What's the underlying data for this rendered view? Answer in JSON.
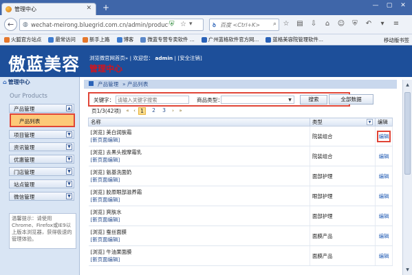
{
  "browser": {
    "tab_title": "管理中心",
    "url": "wechat-meirong.bluegrid.com.cn/admin/productlis",
    "search_placeholder": "百度 <Ctrl+K>"
  },
  "bookmarks": {
    "items": [
      {
        "label": "火狐官方站点",
        "color": "#e5772c"
      },
      {
        "label": "最常访问",
        "color": "#3d7bd0"
      },
      {
        "label": "新手上路",
        "color": "#e5772c"
      },
      {
        "label": "博客",
        "color": "#3d7bd0"
      },
      {
        "label": "微蓝专营专卖软件 ...",
        "color": "#5a87c9"
      },
      {
        "label": "广州蓝格软件官方网...",
        "color": "#2a62b8"
      },
      {
        "label": "蓝格美容院管理软件...",
        "color": "#2a62b8"
      }
    ],
    "mobile_label": "移动版书签"
  },
  "site": {
    "logo": "傲蓝美容",
    "link_home": "浏览微官网首页»",
    "welcome": "| 欢迎您：",
    "user": "admin",
    "logout": "| [安全注销]",
    "title": "管理中心"
  },
  "sidebar": {
    "header": "管理中心",
    "section": "Our Products",
    "groups": [
      "产品管理",
      "项目管理",
      "资讯管理",
      "优惠管理",
      "门店管理",
      "站点管理",
      "微信管理"
    ],
    "active_item": "产品列表",
    "tip": "温馨提示：请使用Chrome、Firefox或IE9以上版本浏览器，获得极速的管理体验。"
  },
  "breadcrumb": {
    "level1": "产品管理",
    "level2": "» 产品列表"
  },
  "filter": {
    "keyword_label": "关键字：",
    "keyword_placeholder": "请输入关键字搜索",
    "type_label": "商品类型：",
    "type_value": "",
    "search_label": "搜索",
    "all_data_label": "全部数据"
  },
  "pager": {
    "info": "页1/3(42项)",
    "pages": [
      "1",
      "2",
      "3"
    ]
  },
  "table": {
    "headers": [
      "名称",
      "类型",
      "编辑"
    ],
    "browse_tag": "[浏览]",
    "sub_link": "[新页面编辑]",
    "edit_label": "编辑",
    "rows": [
      {
        "name": "美白润肤霜",
        "type": "院装组合"
      },
      {
        "name": "去黑头按摩霜乳",
        "type": "院装组合"
      },
      {
        "name": "氨基洗面奶",
        "type": "面部护理"
      },
      {
        "name": "胶原眼部滋养霜",
        "type": "眼部护理"
      },
      {
        "name": "爽肤水",
        "type": "面部护理"
      },
      {
        "name": "蚕丝面膜",
        "type": "面膜产品"
      },
      {
        "name": "牛油果面膜",
        "type": "面膜产品"
      }
    ]
  }
}
